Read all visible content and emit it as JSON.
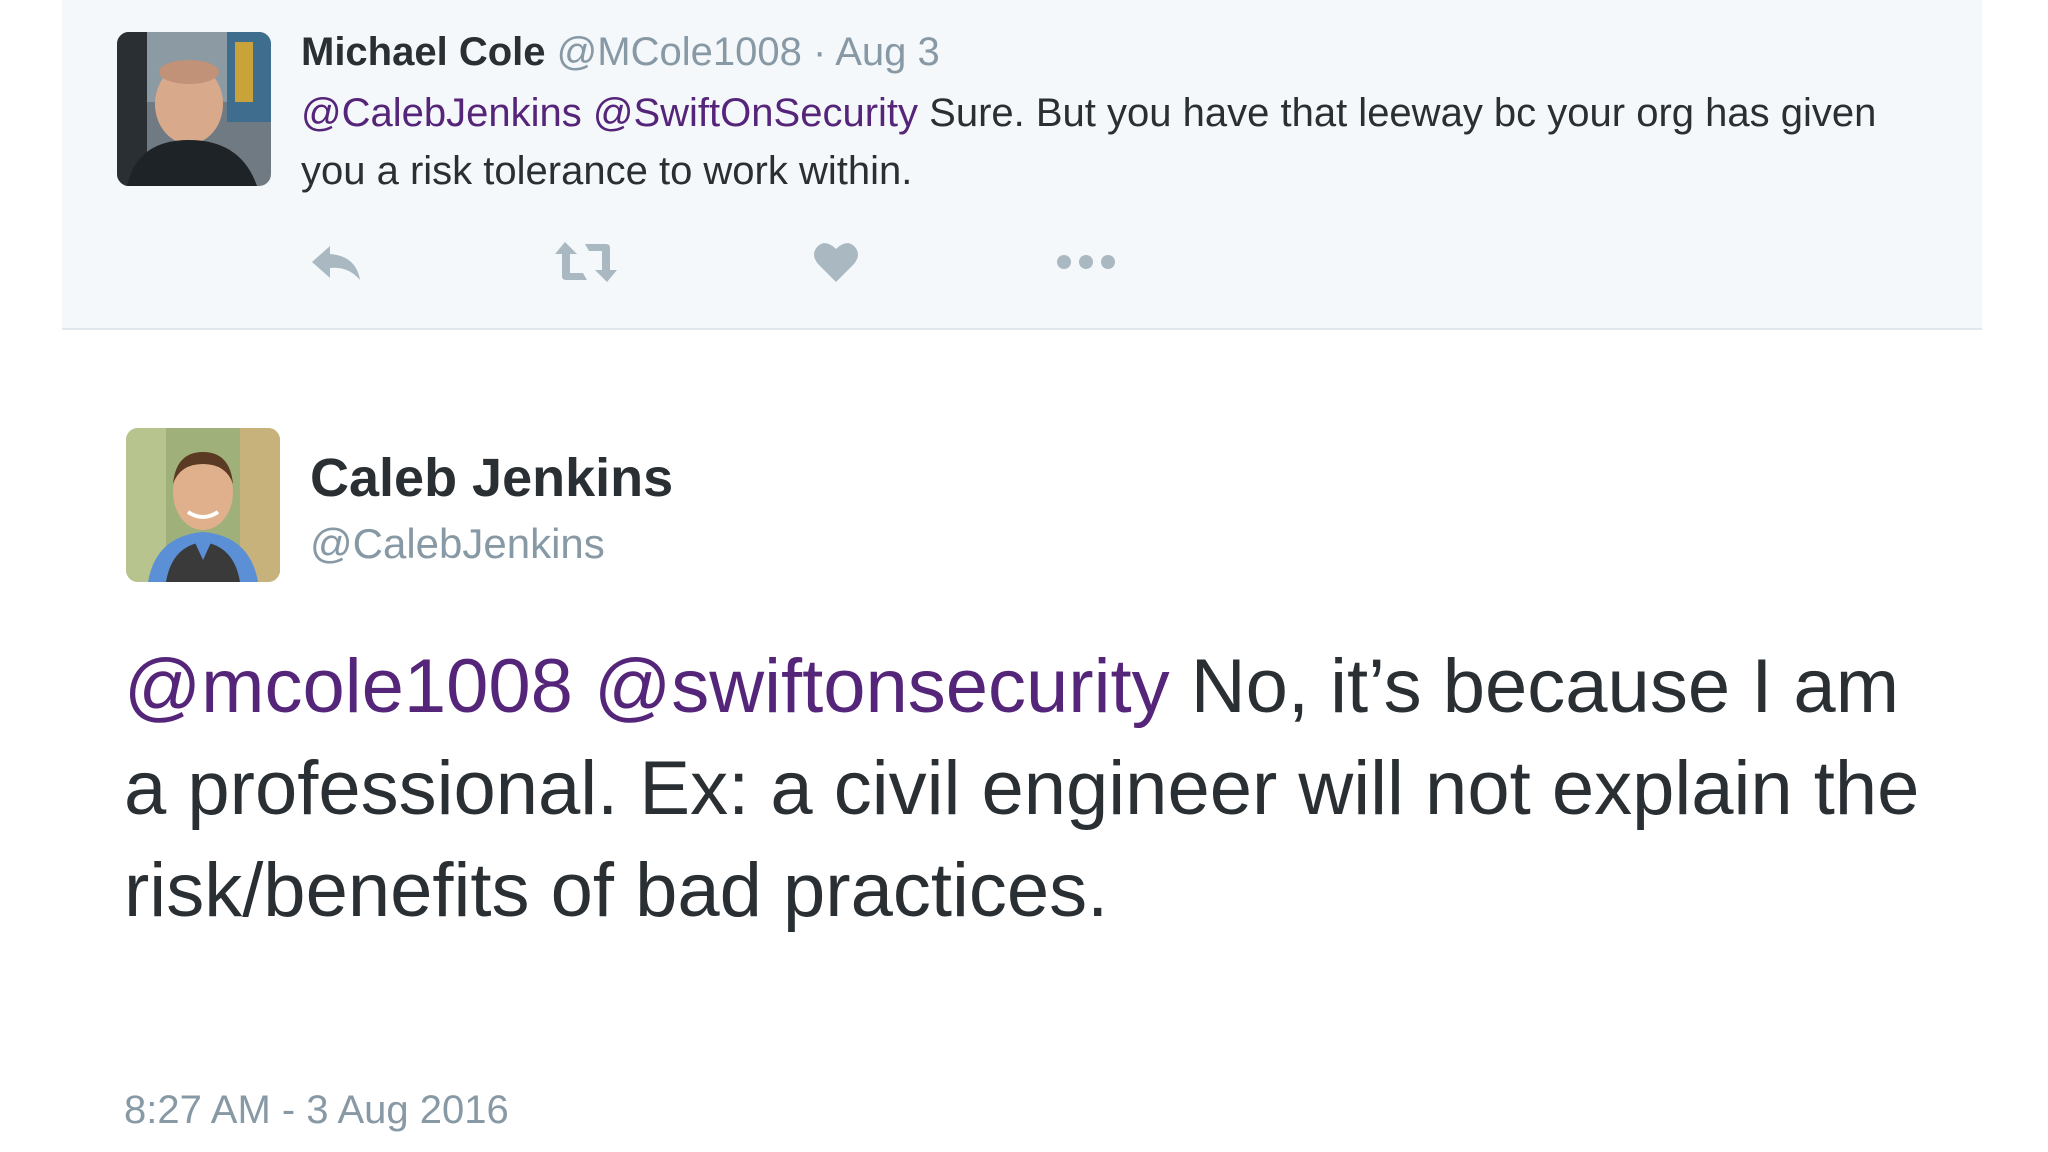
{
  "colors": {
    "mention": "#55257a",
    "secondary_text": "#8899a6",
    "primary_text": "#292f33",
    "action_icon": "#aab8c2",
    "parent_background": "#f5f8fa"
  },
  "parent_tweet": {
    "name": "Michael Cole",
    "handle": "@MCole1008",
    "separator": "·",
    "date": "Aug 3",
    "mention_1": "@CalebJenkins",
    "mention_2": "@SwiftOnSecurity",
    "text": "Sure. But you have that leeway bc your org has given you a risk tolerance to work within.",
    "actions": [
      "reply-icon",
      "retweet-icon",
      "like-icon",
      "more-icon"
    ]
  },
  "main_tweet": {
    "name": "Caleb Jenkins",
    "handle": "@CalebJenkins",
    "mention_1": "@mcole1008",
    "mention_2": "@swiftonsecurity",
    "text": "No, it’s because I am a professional. Ex: a civil engineer will not explain the risk/benefits of bad practices.",
    "timestamp": "8:27 AM - 3 Aug 2016"
  }
}
